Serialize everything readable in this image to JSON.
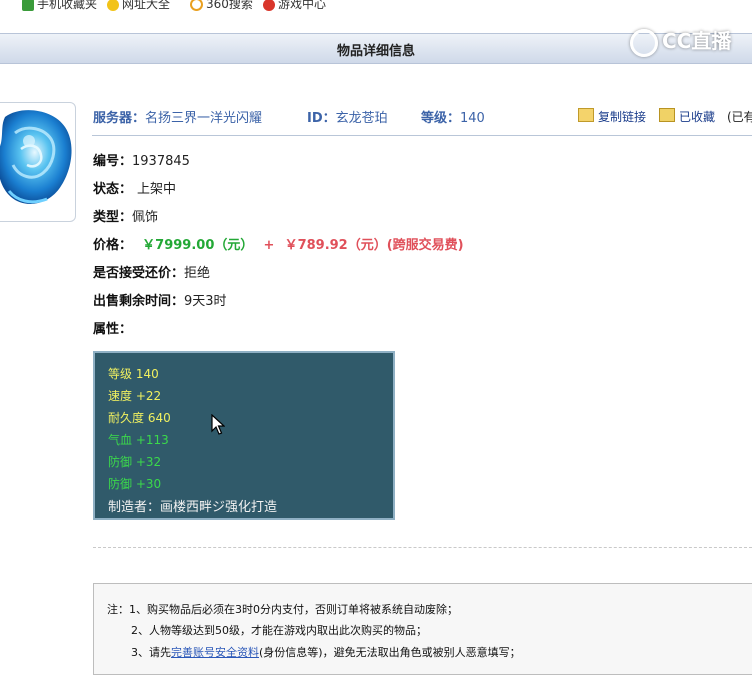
{
  "bookmarks": [
    "手机收藏夹",
    "网址大全",
    "360搜索",
    "游戏中心"
  ],
  "watermark": "CC直播",
  "page_title": "物品详细信息",
  "header": {
    "server_label": "服务器：",
    "server_value": "名扬三界一洋光闪耀",
    "id_label": "ID：",
    "id_value": "玄龙苍珀",
    "level_label": "等级：",
    "level_value": "140",
    "copy_link": "复制链接",
    "favorited": "已收藏",
    "truncated": "(已有"
  },
  "details": {
    "code_label": "编号：",
    "code_value": "1937845",
    "status_label": "状态：",
    "status_value": "上架中",
    "type_label": "类型：",
    "type_value": "佩饰",
    "price_label": "价格：",
    "price_main": "￥7999.00（元）",
    "price_plus": "+",
    "price_fee": "￥789.92（元）(跨服交易费)",
    "counter_label": "是否接受还价：",
    "counter_value": "拒绝",
    "time_label": "出售剩余时间：",
    "time_value": "9天3时",
    "attr_label": "属性："
  },
  "attributes": [
    {
      "text": "等级 140",
      "color": "yellow"
    },
    {
      "text": "速度 +22",
      "color": "yellow"
    },
    {
      "text": "耐久度 640",
      "color": "yellow"
    },
    {
      "text": "气血 +113",
      "color": "green"
    },
    {
      "text": "防御 +32",
      "color": "green"
    },
    {
      "text": "防御 +30",
      "color": "green"
    },
    {
      "text": "制造者：画楼西畔ジ强化打造",
      "color": "white"
    }
  ],
  "notes": {
    "line1": "注：1、购买物品后必须在3时0分内支付，否则订单将被系统自动废除；",
    "line2": "2、人物等级达到50级，才能在游戏内取出此次购买的物品；",
    "line3_prefix": "3、请先",
    "line3_link": "完善账号安全资料",
    "line3_suffix": "(身份信息等)，避免无法取出角色或被别人恶意填写；"
  },
  "colors": {
    "label_blue": "#3c63a8",
    "price_green": "#23a836",
    "price_red": "#e0505a",
    "panel_bg": "#305a6a"
  }
}
